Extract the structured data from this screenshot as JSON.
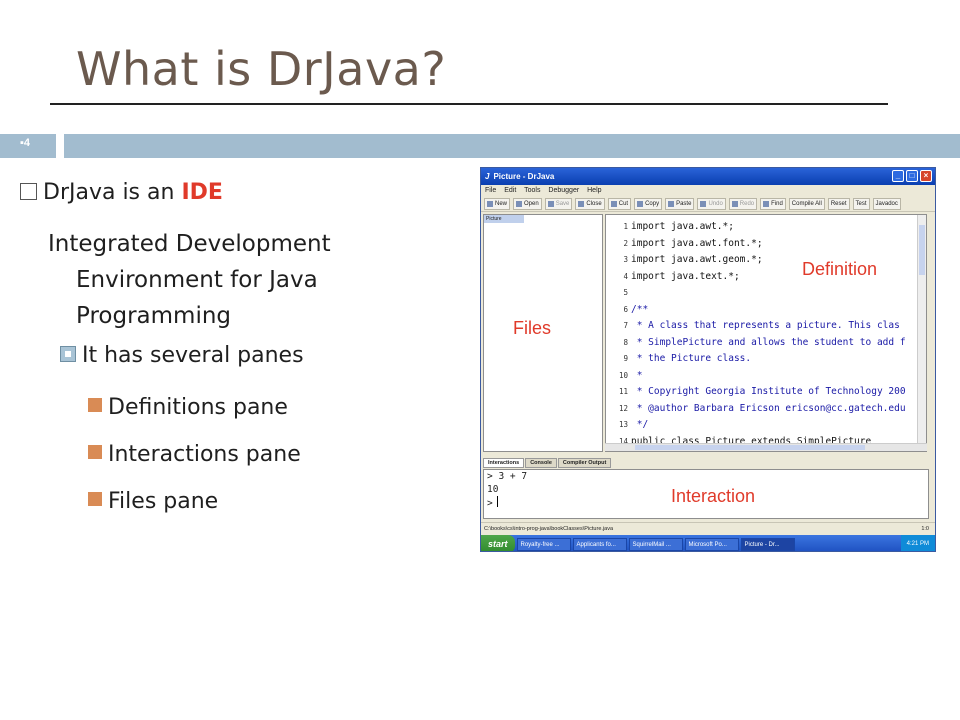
{
  "slide": {
    "title": "What is DrJava?",
    "number": "4"
  },
  "bullets": {
    "main_prefix": "DrJava is an ",
    "main_highlight": "IDE",
    "description_lines": [
      "Integrated Development",
      "Environment for Java",
      "Programming"
    ],
    "sub": "It has several panes",
    "panes": [
      "Definitions pane",
      "Interactions pane",
      "Files pane"
    ]
  },
  "colors": {
    "title": "#6b5a4e",
    "accent_band": "#a2bccf",
    "highlight": "#e03a2a",
    "bullet_orange": "#d98b55"
  },
  "drjava": {
    "window_title": "Picture - DrJava",
    "menu": [
      "File",
      "Edit",
      "Tools",
      "Debugger",
      "Help"
    ],
    "toolbar": [
      "New",
      "Open",
      "Save",
      "Close",
      "Cut",
      "Copy",
      "Paste",
      "Undo",
      "Redo",
      "Find",
      "Compile All",
      "Reset",
      "Test",
      "Javadoc"
    ],
    "open_file": "Picture",
    "code_lines": [
      {
        "n": "1",
        "text": "import java.awt.*;"
      },
      {
        "n": "2",
        "text": "import java.awt.font.*;"
      },
      {
        "n": "3",
        "text": "import java.awt.geom.*;"
      },
      {
        "n": "4",
        "text": "import java.text.*;"
      },
      {
        "n": "5",
        "text": ""
      },
      {
        "n": "6",
        "text": "/**"
      },
      {
        "n": "7",
        "text": " * A class that represents a picture.  This clas"
      },
      {
        "n": "8",
        "text": " * SimplePicture and allows the student to add f"
      },
      {
        "n": "9",
        "text": " * the Picture class."
      },
      {
        "n": "10",
        "text": " *"
      },
      {
        "n": "11",
        "text": " * Copyright Georgia Institute of Technology 200"
      },
      {
        "n": "12",
        "text": " * @author Barbara Ericson ericson@cc.gatech.edu"
      },
      {
        "n": "13",
        "text": " */"
      },
      {
        "n": "14",
        "text": "public class Picture extends SimplePicture"
      }
    ],
    "tabs": [
      "Interactions",
      "Console",
      "Compiler Output"
    ],
    "interactions": [
      "> 3 + 7",
      "10",
      ">"
    ],
    "status_path": "C:\\books\\cs\\intro-prog-java\\bookClasses\\Picture.java",
    "status_pos": "1:0",
    "taskbar": {
      "start": "start",
      "tasks": [
        "Royalty-free ...",
        "Applicants fo...",
        "SquirrelMail ...",
        "Microsoft Po...",
        "Picture - Dr..."
      ],
      "clock": "4:21 PM"
    },
    "annotations": {
      "files": "Files",
      "definition": "Definition",
      "interaction": "Interaction"
    }
  }
}
